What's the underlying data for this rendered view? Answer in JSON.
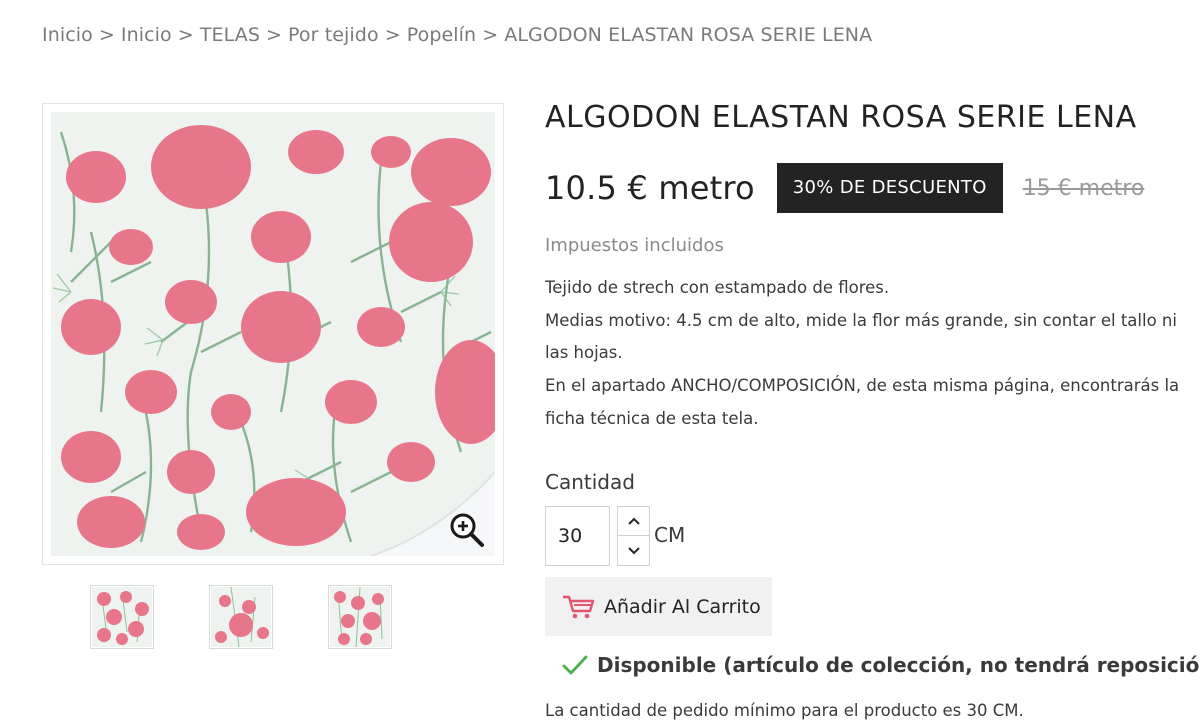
{
  "breadcrumb": {
    "items": [
      "Inicio",
      "Inicio",
      "TELAS",
      "Por tejido",
      "Popelín"
    ],
    "separator": ">",
    "current": "ALGODON ELASTAN ROSA SERIE LENA"
  },
  "product": {
    "title": "ALGODON ELASTAN ROSA SERIE LENA",
    "price": "10.5 € metro",
    "discount_badge": "30% DE DESCUENTO",
    "old_price": "15 € metro",
    "tax_note": "Impuestos incluidos",
    "description": [
      "Tejido de strech con estampado de flores.",
      "Medias motivo: 4.5 cm de alto, mide la flor más grande, sin contar el tallo ni las hojas.",
      "En el apartado ANCHO/COMPOSICIÓN, de esta misma página, encontrarás la ficha técnica de esta tela."
    ]
  },
  "quantity": {
    "label": "Cantidad",
    "value": "30",
    "unit": "CM"
  },
  "cart": {
    "add_label": "Añadir Al Carrito",
    "icon": "cart-icon"
  },
  "availability": {
    "text": "Disponible (artículo de colección, no tendrá reposición)",
    "icon": "check-icon"
  },
  "min_order": "La cantidad de pedido mínimo para el producto es 30 CM.",
  "gallery": {
    "thumbnail_count": 3,
    "zoom_icon": "zoom-in-icon"
  },
  "colors": {
    "badge_bg": "#232323",
    "check": "#4caf50",
    "cart_icon": "#e0576f",
    "button_bg": "#f1f1f1",
    "fabric_bg": "#eef3f0",
    "flower": "#e8768a"
  }
}
